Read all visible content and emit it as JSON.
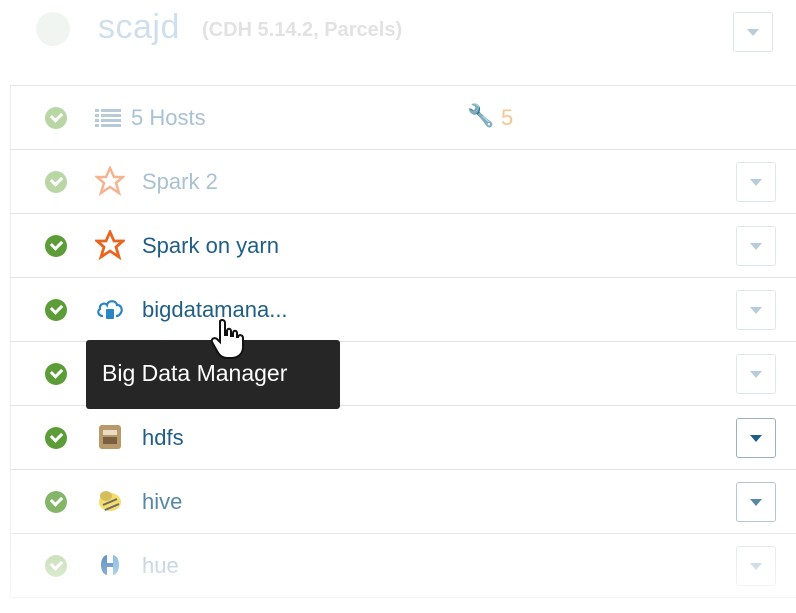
{
  "cluster": {
    "name": "scajd",
    "version": "(CDH 5.14.2, Parcels)"
  },
  "hosts_row": {
    "label": "5 Hosts",
    "config_issues": "5"
  },
  "services": [
    {
      "label": "Spark 2",
      "icon": "spark-star-icon",
      "status": "good"
    },
    {
      "label": "Spark on yarn",
      "icon": "spark-star-icon",
      "status": "good"
    },
    {
      "label": "bigdatamana...",
      "icon": "cloud-icon",
      "status": "good"
    },
    {
      "label": "",
      "icon": "app-icon",
      "status": "good"
    },
    {
      "label": "hdfs",
      "icon": "hdfs-icon",
      "status": "good"
    },
    {
      "label": "hive",
      "icon": "hive-bee-icon",
      "status": "good"
    },
    {
      "label": "hue",
      "icon": "hue-icon",
      "status": "good"
    }
  ],
  "tooltip": {
    "text": "Big Data Manager"
  },
  "colors": {
    "status_good": "#5c9d38",
    "link": "#1f5f86",
    "tooltip_bg": "#262626",
    "spark_orange": "#e8661f"
  }
}
